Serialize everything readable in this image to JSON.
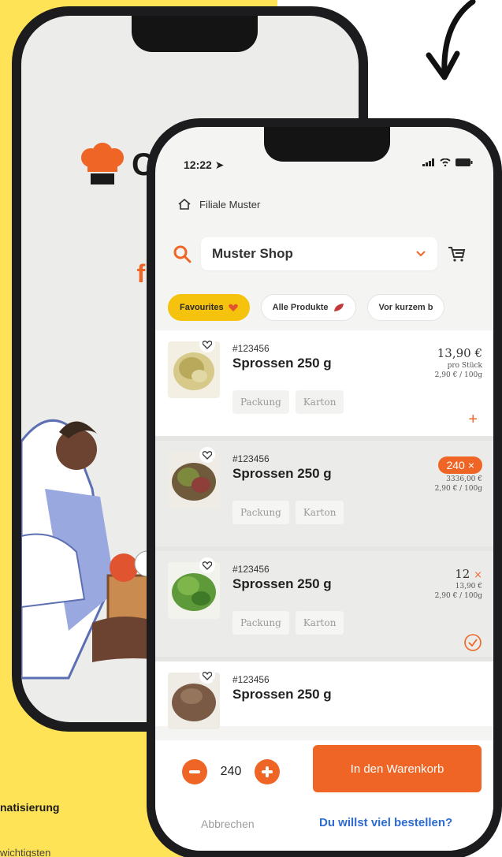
{
  "background": {
    "accent": "#ffe356"
  },
  "back_phone": {
    "logo_text": "Cl",
    "hero_title": "Die B\nfür den"
  },
  "front_phone": {
    "status_bar": {
      "time": "12:22"
    },
    "store": {
      "label": "Filiale Muster"
    },
    "shop_select": {
      "value": "Muster Shop"
    },
    "tabs": [
      {
        "label": "Favourites",
        "icon": "heart-icon",
        "active": true
      },
      {
        "label": "Alle Produkte",
        "icon": "leaf-icon",
        "active": false
      },
      {
        "label": "Vor kurzem b",
        "active": false
      }
    ],
    "products": [
      {
        "sku": "#123456",
        "name": "Sprossen 250 g",
        "tags": [
          "Packung",
          "Karton"
        ],
        "price": "13,90 €",
        "unit": "pro Stück",
        "unit_price": "2,90 € / 100g"
      },
      {
        "sku": "#123456",
        "name": "Sprossen 250 g",
        "tags": [
          "Packung",
          "Karton"
        ],
        "quantity": "240",
        "total": "3336,00 €",
        "unit_price": "2,90 € / 100g"
      },
      {
        "sku": "#123456",
        "name": "Sprossen 250 g",
        "tags": [
          "Packung",
          "Karton"
        ],
        "quantity": "12",
        "total": "13,90 €",
        "unit_price": "2,90 € / 100g"
      },
      {
        "sku": "#123456",
        "name": "Sprossen 250 g"
      }
    ],
    "bottom_bar": {
      "quantity": "240",
      "add_to_cart": "In den Warenkorb",
      "cancel": "Abbrechen",
      "bulk_order": "Du willst viel bestellen?"
    },
    "colors": {
      "orange": "#ef6526",
      "yellow": "#f5c20d",
      "link": "#2d6bd2"
    }
  },
  "captions": {
    "line1": "natisierung",
    "line2": "wichtigsten"
  }
}
